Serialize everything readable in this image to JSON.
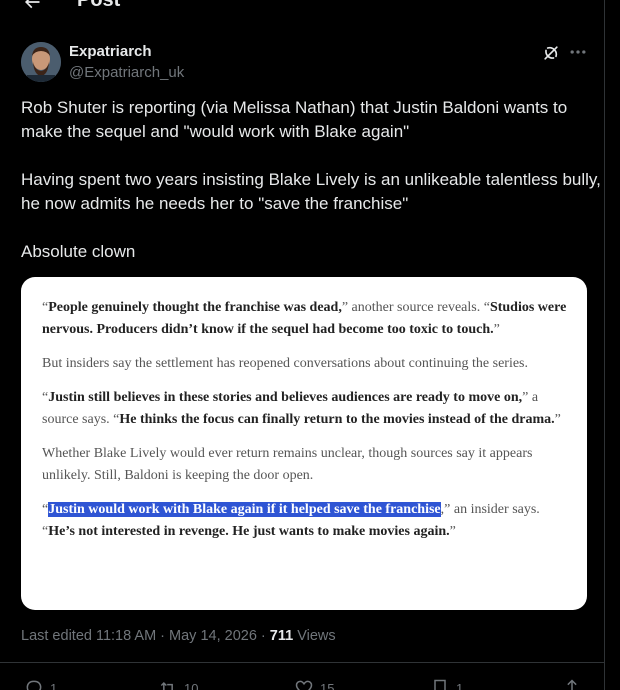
{
  "header": {
    "title": "Post"
  },
  "author": {
    "name": "Expatriarch",
    "handle": "@Expatriarch_uk"
  },
  "tweet": {
    "line1": "Rob Shuter is reporting (via Melissa Nathan) that Justin Baldoni wants to make the sequel and \"would work with Blake again\"",
    "line2": "Having spent two years insisting Blake Lively is an unlikeable talentless bully, he now admits he needs her to \"save the franchise\"",
    "line3": "Absolute clown"
  },
  "article": {
    "p1_open": "“",
    "p1_bold1": "People genuinely thought the franchise was dead,",
    "p1_mid": "” another source reveals. “",
    "p1_bold2": "Studios were nervous. Producers didn’t know if the sequel had become too toxic to touch.",
    "p1_close": "”",
    "p2": "But insiders say the settlement has reopened conversations about continuing the series.",
    "p3_open": "“",
    "p3_bold1": "Justin still believes in these stories and believes audiences are ready to move on,",
    "p3_mid": "” a source says. “",
    "p3_bold2": "He thinks the focus can finally return to the movies instead of the drama.",
    "p3_close": "”",
    "p4": "Whether Blake Lively would ever return remains unclear, though sources say it appears unlikely. Still, Baldoni is keeping the door open.",
    "p5_open": "“",
    "p5_highlight": "Justin would work with Blake again if it helped save the franchise",
    "p5_mid": ",” an insider says. “",
    "p5_bold2": "He’s not interested in revenge. He just wants to make movies again.",
    "p5_close": "”"
  },
  "meta": {
    "edited": "Last edited 11:18 AM · May 14, 2026 · ",
    "views_count": "711",
    "views_label": " Views"
  },
  "actions": {
    "replies": "1",
    "reposts": "10",
    "likes": "15",
    "bookmarks": "1"
  }
}
